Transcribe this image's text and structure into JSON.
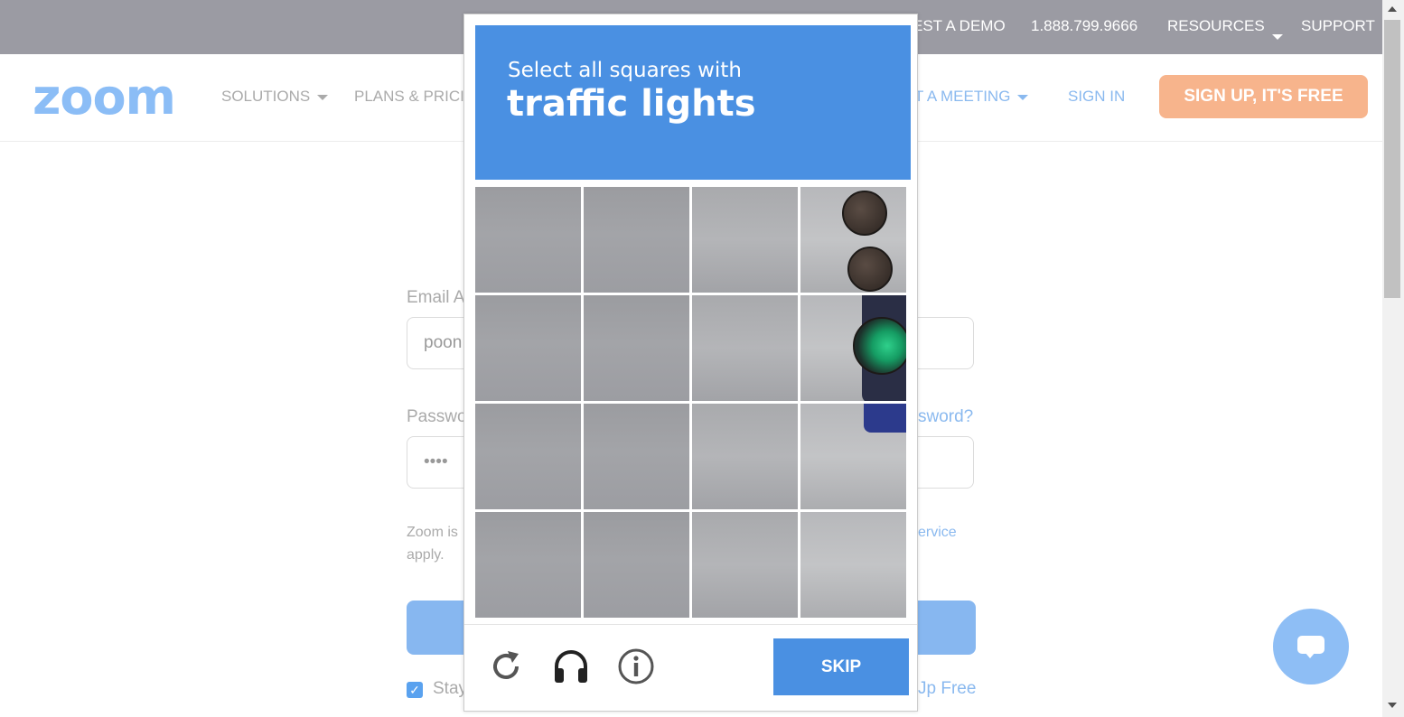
{
  "topbar": {
    "demo": "EST A DEMO",
    "phone": "1.888.799.9666",
    "resources": "RESOURCES",
    "support": "SUPPORT"
  },
  "nav": {
    "logo": "zoom",
    "solutions": "SOLUTIONS",
    "plans": "PLANS & PRICI",
    "meeting": "T A MEETING",
    "sign_in": "SIGN IN",
    "sign_up": "SIGN UP, IT'S FREE"
  },
  "form": {
    "email_label": "Email A",
    "email_value": "poon",
    "password_label": "Passwo",
    "forgot": "sword?",
    "password_value": "••••",
    "terms_line1": "Zoom is",
    "terms_link": "ervice",
    "terms_line2": "apply.",
    "stay": "Stay",
    "signup_free": "Jp Free"
  },
  "captcha": {
    "instruction": "Select all squares with",
    "target": "traffic lights",
    "skip_label": "SKIP",
    "tiles": 16
  },
  "colors": {
    "captcha_blue": "#4a90e2",
    "zoom_blue": "#8bbdf6",
    "signup_orange": "#f7b48c"
  },
  "icons": [
    "reload-icon",
    "headphones-icon",
    "info-icon",
    "chat-icon"
  ]
}
